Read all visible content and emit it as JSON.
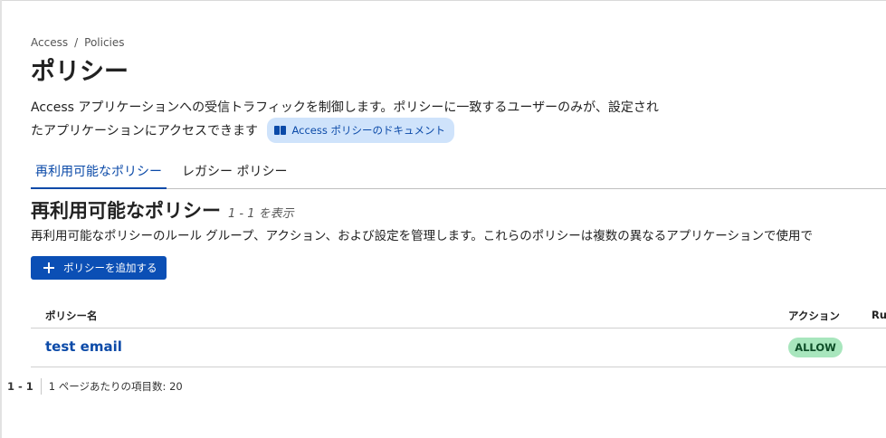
{
  "breadcrumb": {
    "root": "Access",
    "separator": "/",
    "current": "Policies"
  },
  "page": {
    "title": "ポリシー",
    "description": "Access アプリケーションへの受信トラフィックを制御します。ポリシーに一致するユーザーのみが、設定されたアプリケーションにアクセスできます",
    "doc_link_label": "Access ポリシーのドキュメント",
    "doc_link_icon": "book-icon"
  },
  "tabs": [
    {
      "label": "再利用可能なポリシー",
      "active": true
    },
    {
      "label": "レガシー ポリシー",
      "active": false
    }
  ],
  "section": {
    "title": "再利用可能なポリシー",
    "count": "1 - 1 を表示",
    "description": "再利用可能なポリシーのルール グループ、アクション、および設定を管理します。これらのポリシーは複数の異なるアプリケーションで使用で",
    "add_button_label": "ポリシーを追加する",
    "add_button_icon": "plus-icon"
  },
  "table": {
    "columns": {
      "name": "ポリシー名",
      "action": "アクション",
      "rules": "Ru"
    },
    "rows": [
      {
        "name": "test email",
        "action": "ALLOW"
      }
    ]
  },
  "pagination": {
    "range": "1 - 1",
    "per_page": "1 ページあたりの項目数: 20"
  },
  "colors": {
    "accent": "#0b4aa8",
    "button": "#0b4fb5",
    "allow_badge": "#a8e6bd",
    "doc_pill": "#cfe3fb"
  }
}
